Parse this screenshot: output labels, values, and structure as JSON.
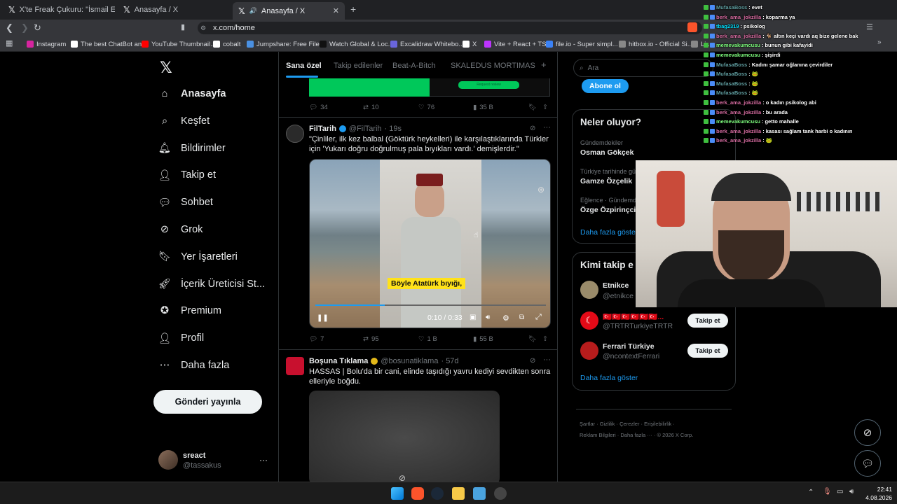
{
  "browser": {
    "tabs": [
      {
        "title": "X'te Freak Çukuru: \"İsmail Emre, Sule"
      },
      {
        "title": "Anasayfa / X"
      },
      {
        "title": "Anasayfa / X"
      }
    ],
    "url": "x.com/home",
    "bookmarks": [
      {
        "label": "Instagram",
        "color": "#d6249f"
      },
      {
        "label": "The best ChatBot an...",
        "color": "#ffffff"
      },
      {
        "label": "YouTube Thumbnail...",
        "color": "#ff0000"
      },
      {
        "label": "cobalt",
        "color": "#ffffff"
      },
      {
        "label": "Jumpshare: Free File...",
        "color": "#4a90e2"
      },
      {
        "label": "Watch Global & Loc...",
        "color": "#111111"
      },
      {
        "label": "Excalidraw Whitebo...",
        "color": "#6965db"
      },
      {
        "label": "X",
        "color": "#ffffff"
      },
      {
        "label": "Vite + React + TS",
        "color": "#bd34fe"
      },
      {
        "label": "file.io - Super simpl...",
        "color": "#3b82f6"
      },
      {
        "label": "hitbox.io - Official Si...",
        "color": "#888888"
      },
      {
        "label": "Li...",
        "color": "#888888"
      }
    ]
  },
  "sidebar": {
    "items": [
      {
        "label": "Anasayfa",
        "icon": "home-icon"
      },
      {
        "label": "Keşfet",
        "icon": "search-icon"
      },
      {
        "label": "Bildirimler",
        "icon": "bell-icon"
      },
      {
        "label": "Takip et",
        "icon": "add-user-icon"
      },
      {
        "label": "Sohbet",
        "icon": "chat-icon"
      },
      {
        "label": "Grok",
        "icon": "grok-icon"
      },
      {
        "label": "Yer İşaretleri",
        "icon": "bookmark-icon"
      },
      {
        "label": "İçerik Üreticisi St...",
        "icon": "rocket-icon"
      },
      {
        "label": "Premium",
        "icon": "verified-icon"
      },
      {
        "label": "Profil",
        "icon": "person-icon"
      },
      {
        "label": "Daha fazla",
        "icon": "more-circle-icon"
      }
    ],
    "post_button": "Gönderi yayınla",
    "user": {
      "name": "sreact",
      "handle": "@tassakus"
    }
  },
  "main": {
    "tabs": [
      "Sana özel",
      "Takip edilenler",
      "Beat-A-Bitch",
      "SKALEDUS MORTIMAS"
    ],
    "ad_button": "Request review",
    "tweet0_stats": {
      "replies": "34",
      "retweets": "10",
      "likes": "76",
      "views": "35 B"
    },
    "tweet1": {
      "name": "FilTarih",
      "handle": "@FilTarih",
      "time": "· 19s",
      "text": "\"Çinliler, ilk kez balbal (Göktürk heykelleri) ile karşılaştıklarında Türkler için 'Yukarı doğru doğrulmuş pala bıyıkları vardı.' demişlerdir.\"",
      "video_caption": "Böyle Atatürk bıyığı,",
      "video_time": "0:10 / 0:33",
      "video_progress": 0.3,
      "stats": {
        "replies": "7",
        "retweets": "95",
        "likes": "1 B",
        "views": "55 B"
      }
    },
    "tweet2": {
      "name": "Boşuna Tıklama",
      "handle": "@bosunatiklama",
      "time": "· 57d",
      "text": "HASSAS | Bolu'da bir cani, elinde taşıdığı yavru kediyi sevdikten sonra elleriyle boğdu."
    }
  },
  "right": {
    "search_placeholder": "Ara",
    "subscribe_button": "Abone ol",
    "trends_title": "Neler oluyor?",
    "trends": [
      {
        "category": "Gündemdekiler",
        "name": "Osman Gökçek"
      },
      {
        "category": "Türkiye tarihinde gü",
        "name": "Gamze Özçelik"
      },
      {
        "category": "Eğlence · Gündemde",
        "name": "Özge Özpirinçci"
      }
    ],
    "trends_more": "Daha fazla göster",
    "whotofollow_title": "Kimi takip e",
    "follow": [
      {
        "name": "Etnikce",
        "handle": "@etnikce",
        "button": ""
      },
      {
        "name": "🇹🇷🇹🇷🇹🇷🇹🇷🇹🇷🇹🇷...",
        "handle": "@TRTRTurkiyeTRTR",
        "button": "Takip et"
      },
      {
        "name": "Ferrari Türkiye",
        "handle": "@ncontextFerrari",
        "button": "Takip et"
      }
    ],
    "follow_more": "Daha fazla göster",
    "footer": [
      "Şartlar",
      "Gizlilik",
      "Çerezler",
      "Erişilebilirlik",
      "Reklam Bilgileri",
      "Daha fazla ···",
      "© 2026 X Corp."
    ]
  },
  "chat": [
    {
      "user": "MufasaBoss",
      "msg": "evet",
      "color": "#5f9ea0"
    },
    {
      "user": "berk_ama_jokzilla",
      "msg": "koparma ya",
      "color": "#d66ba0"
    },
    {
      "user": "tbag2319",
      "msg": "psikolog",
      "color": "#00e0ff"
    },
    {
      "user": "berk_ama_jokzilla",
      "msg": "🐐 altın keçi vardı aq bize gelene bak",
      "color": "#d66ba0"
    },
    {
      "user": "memevakumcusu",
      "msg": "bunun gibi kafayidi",
      "color": "#7fff7f"
    },
    {
      "user": "memevakumcusu",
      "msg": "şişirdi",
      "color": "#7fff7f"
    },
    {
      "user": "MufasaBoss",
      "msg": "Kadını şamar oğlanına çevirdiler",
      "color": "#5f9ea0"
    },
    {
      "user": "MufasaBoss",
      "msg": "🐸",
      "color": "#5f9ea0"
    },
    {
      "user": "MufasaBoss",
      "msg": "🐸",
      "color": "#5f9ea0"
    },
    {
      "user": "MufasaBoss",
      "msg": "🐸",
      "color": "#5f9ea0"
    },
    {
      "user": "berk_ama_jokzilla",
      "msg": "o kadın psikolog abi",
      "color": "#d66ba0"
    },
    {
      "user": "berk_ama_jokzilla",
      "msg": "bu arada",
      "color": "#d66ba0"
    },
    {
      "user": "memevakumcusu",
      "msg": "getto mahalle",
      "color": "#7fff7f"
    },
    {
      "user": "berk_ama_jokzilla",
      "msg": "kasası sağlam tank harbi o kadının",
      "color": "#d66ba0"
    },
    {
      "user": "berk_ama_jokzilla",
      "msg": "🐸",
      "color": "#d66ba0"
    }
  ],
  "taskbar": {
    "time": "22:41",
    "date": "4.08.2026"
  },
  "colors": {
    "accent": "#1d9bf0",
    "green_ad": "#00c85a",
    "caption_bg": "#ffe21a"
  }
}
